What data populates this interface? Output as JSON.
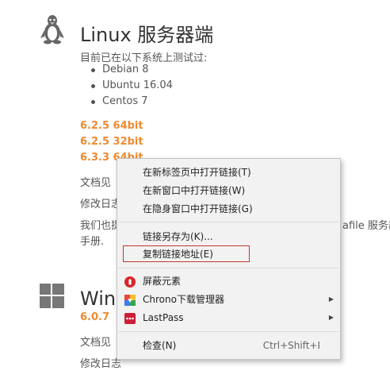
{
  "linux": {
    "title": "Linux 服务器端",
    "tested_label": "目前已在以下系统上测试过:",
    "systems": [
      "Debian 8",
      "Ubuntu 16.04",
      "Centos 7"
    ],
    "downloads": [
      "6.2.5 64bit",
      "6.2.5 32bit",
      "6.3.3 64bit"
    ],
    "doc_label": "文档见",
    "changelog_label": "修改日志",
    "more_text_left": "我们也提",
    "more_text_right": "afile 服务器",
    "more_text_line2": "手册."
  },
  "windows": {
    "title": "Wind",
    "version": "6.0.7",
    "doc_label": "文档见",
    "changelog_label": "修改日志"
  },
  "context_menu": {
    "items": [
      {
        "label": "在新标签页中打开链接(T)"
      },
      {
        "label": "在新窗口中打开链接(W)"
      },
      {
        "label": "在隐身窗口中打开链接(G)"
      },
      {
        "label": "链接另存为(K)..."
      },
      {
        "label": "复制链接地址(E)"
      },
      {
        "label": "屏蔽元素",
        "icon": "adblock-icon"
      },
      {
        "label": "Chrono下载管理器",
        "icon": "chrono-icon",
        "submenu": true
      },
      {
        "label": "LastPass",
        "icon": "lastpass-icon",
        "submenu": true
      },
      {
        "label": "检查(N)",
        "shortcut": "Ctrl+Shift+I"
      }
    ],
    "submenu_arrow": "▶"
  },
  "colors": {
    "accent_link": "#f08a30",
    "highlight_border": "#c0392b",
    "menu_bg": "#f2f2f2"
  }
}
